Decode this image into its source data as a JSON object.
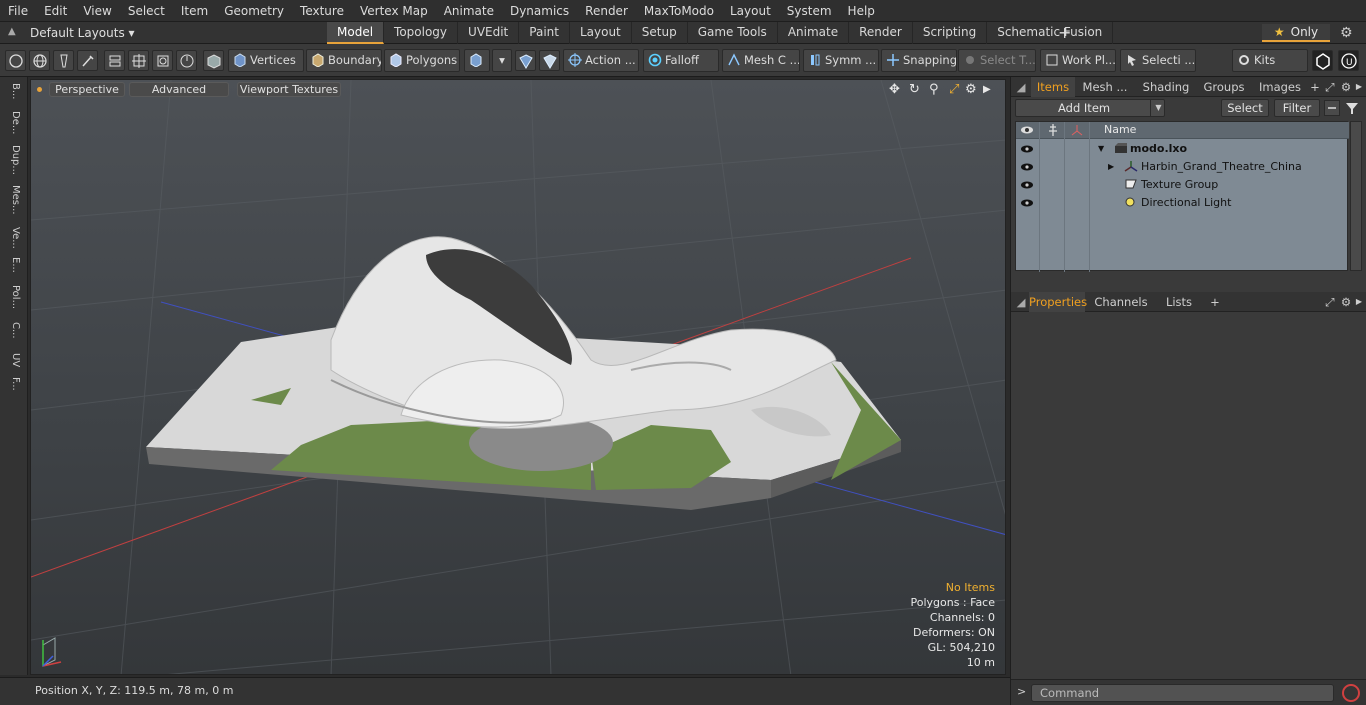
{
  "menu": [
    "File",
    "Edit",
    "View",
    "Select",
    "Item",
    "Geometry",
    "Texture",
    "Vertex Map",
    "Animate",
    "Dynamics",
    "Render",
    "MaxToModo",
    "Layout",
    "System",
    "Help"
  ],
  "layout_select": "Default Layouts",
  "tabs": [
    "Model",
    "Topology",
    "UVEdit",
    "Paint",
    "Layout",
    "Setup",
    "Game Tools",
    "Animate",
    "Render",
    "Scripting",
    "Schematic Fusion"
  ],
  "only_label": "Only",
  "toolbar": {
    "vertices": "Vertices",
    "boundary": "Boundary",
    "polygons": "Polygons",
    "action": "Action",
    "falloff": "Falloff",
    "mesh": "Mesh C ...",
    "symm": "Symm ...",
    "snapping": "Snapping",
    "select_t": "Select T...",
    "work_pl": "Work Pl...",
    "selecti": "Selecti ...",
    "kits": "Kits",
    "dots": "..."
  },
  "left_strip": [
    "B...",
    "De...",
    "Dup...",
    "Mes...",
    "Ve...",
    "E...",
    "Pol...",
    "C...",
    "UV",
    "F..."
  ],
  "viewport": {
    "perspective": "Perspective",
    "advanced": "Advanced",
    "viewport_textures": "Viewport Textures",
    "info": {
      "no_items": "No Items",
      "polygons": "Polygons : Face",
      "channels": "Channels: 0",
      "deformers": "Deformers: ON",
      "gl": "GL: 504,210",
      "scale": "10 m"
    }
  },
  "items_panel": {
    "tabs": [
      "Items",
      "Mesh ...",
      "Shading",
      "Groups",
      "Images"
    ],
    "add_item": "Add Item",
    "select": "Select",
    "filter": "Filter",
    "column_name": "Name",
    "rows": [
      {
        "label": "modo.lxo",
        "bold": true
      },
      {
        "label": "Harbin_Grand_Theatre_China"
      },
      {
        "label": "Texture Group"
      },
      {
        "label": "Directional Light"
      }
    ]
  },
  "props_panel": {
    "tabs": [
      "Properties",
      "Channels",
      "Lists"
    ]
  },
  "command": {
    "prompt": ">",
    "placeholder": "Command"
  },
  "status": {
    "position": "Position X, Y, Z:   119.5 m, 78 m, 0 m"
  },
  "colors": {
    "accent": "#e8a33a",
    "viewport_top": "#4d5156",
    "items_bg": "#7f8a94"
  }
}
